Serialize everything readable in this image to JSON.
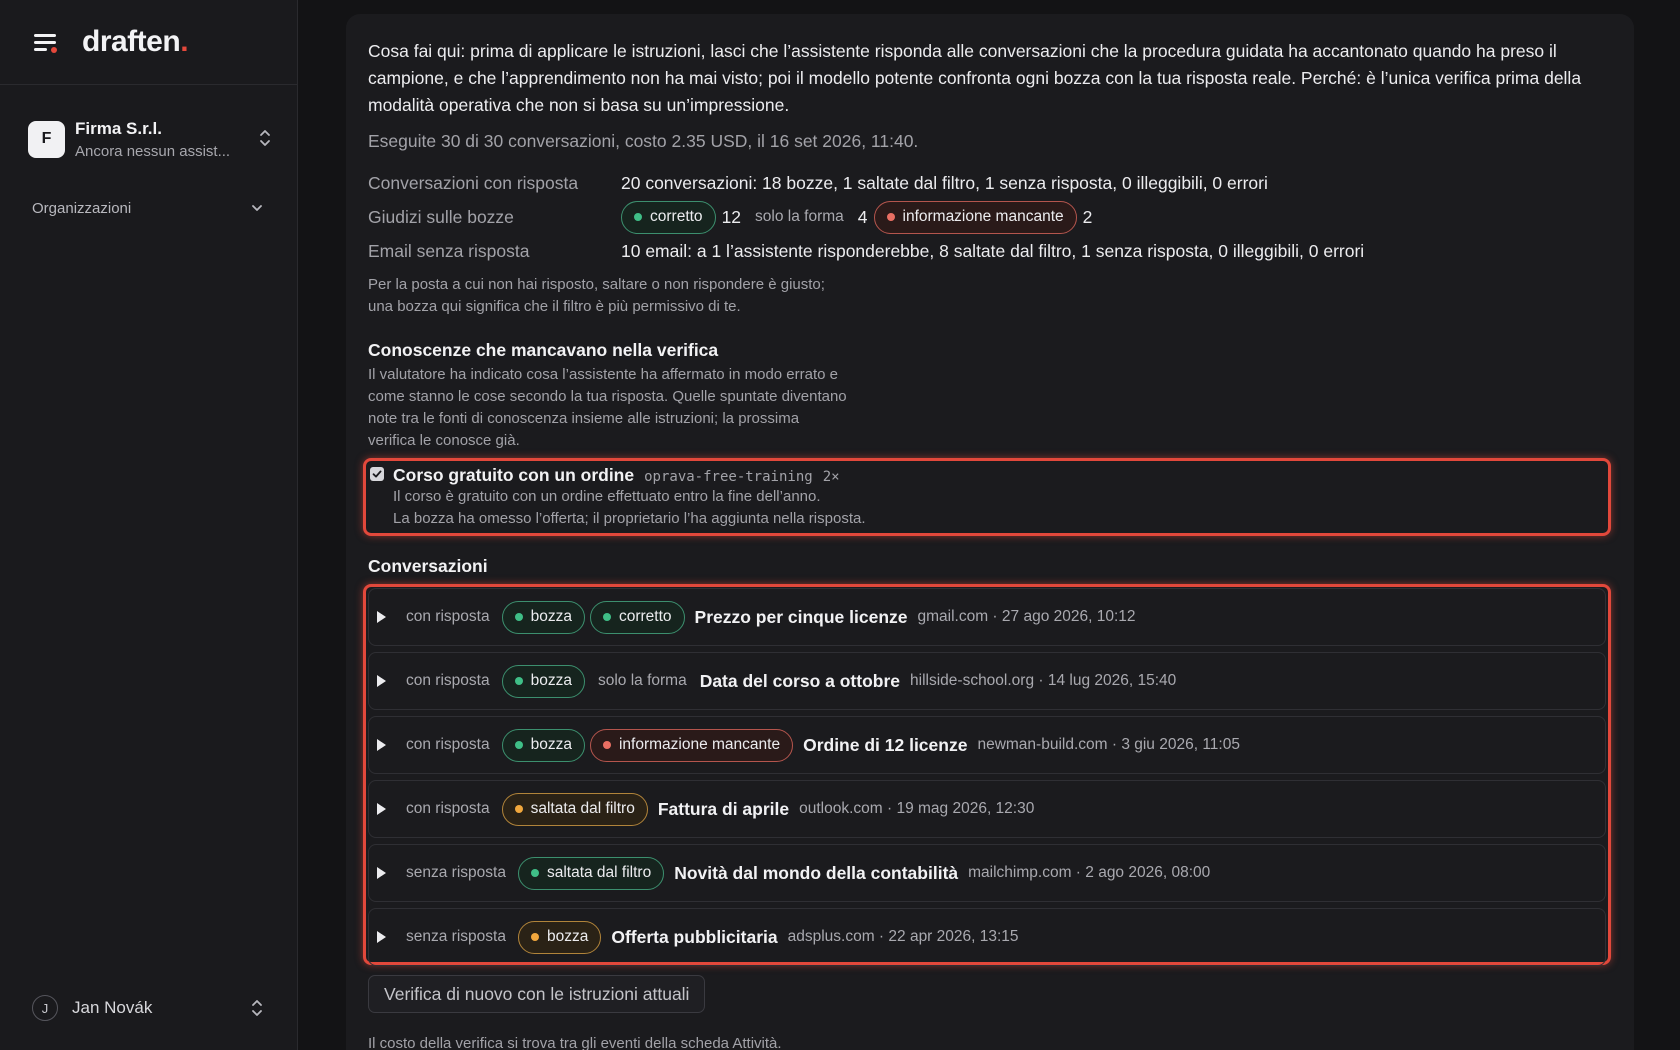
{
  "brand": {
    "name": "draften",
    "dot": "."
  },
  "org": {
    "initial": "F",
    "name": "Firma S.r.l.",
    "subtitle": "Ancora nessun assist..."
  },
  "sidebar": {
    "section_label": "Organizzazioni"
  },
  "user": {
    "initial": "J",
    "name": "Jan Novák"
  },
  "intro": "Cosa fai qui: prima di applicare le istruzioni, lasci che l’assistente risponda alle conversazioni che la procedura guidata ha accantonato quando ha preso il campione, e che l’apprendimento non ha mai visto; poi il modello potente confronta ogni bozza con la tua risposta reale. Perché: è l’unica verifica prima della modalità operativa che non si basa su un’impressione.",
  "run_meta": "Eseguite 30 di 30 conversazioni, costo 2.35 USD, il 16 set 2026, 11:40.",
  "stats": {
    "replied_label": "Conversazioni con risposta",
    "replied_value": "20 conversazioni: 18 bozze, 1 saltate dal filtro, 1 senza risposta, 0 illeggibili, 0 errori",
    "judgements_label": "Giudizi sulle bozze",
    "judgements": {
      "correct_label": "corretto",
      "correct_count": "12",
      "form_label": "solo la forma",
      "form_count": "4",
      "missing_label": "informazione mancante",
      "missing_count": "2"
    },
    "unreplied_label": "Email senza risposta",
    "unreplied_value": "10 email: a 1 l’assistente risponderebbe, 8 saltate dal filtro, 1 senza risposta, 0 illeggibili, 0 errori",
    "note_line1": "Per la posta a cui non hai risposto, saltare o non rispondere è giusto;",
    "note_line2": "una bozza qui significa che il filtro è più permissivo di te."
  },
  "knowledge": {
    "title": "Conoscenze che mancavano nella verifica",
    "desc_line1": "Il valutatore ha indicato cosa l’assistente ha affermato in modo errato e",
    "desc_line2": "come stanno le cose secondo la tua risposta. Quelle spuntate diventano",
    "desc_line3": "note tra le fonti di conoscenza insieme alle istruzioni; la prossima",
    "desc_line4": "verifica le conosce già.",
    "item": {
      "checked": true,
      "title": "Corso gratuito con un ordine",
      "code": "oprava-free-training",
      "multiplier": "2×",
      "line1": "Il corso è gratuito con un ordine effettuato entro la fine dell’anno.",
      "line2": "La bozza ha omesso l’offerta; il proprietario l’ha aggiunta nella risposta."
    }
  },
  "conversations": {
    "title": "Conversazioni",
    "rows": [
      {
        "status": "con risposta",
        "tag1": "bozza",
        "tag2": "corretto",
        "subject": "Prezzo per cinque licenze",
        "meta": "gmail.com · 27 ago 2026, 10:12"
      },
      {
        "status": "con risposta",
        "tag1": "bozza",
        "tag2": "solo la forma",
        "subject": "Data del corso a ottobre",
        "meta": "hillside-school.org · 14 lug 2026, 15:40"
      },
      {
        "status": "con risposta",
        "tag1": "bozza",
        "tag2": "informazione mancante",
        "subject": "Ordine di 12 licenze",
        "meta": "newman-build.com · 3 giu 2026, 11:05"
      },
      {
        "status": "con risposta",
        "tag1": "saltata dal filtro",
        "subject": "Fattura di aprile",
        "meta": "outlook.com · 19 mag 2026, 12:30"
      },
      {
        "status": "senza risposta",
        "tag1": "saltata dal filtro",
        "subject": "Novità dal mondo della contabilità",
        "meta": "mailchimp.com · 2 ago 2026, 08:00"
      },
      {
        "status": "senza risposta",
        "tag1": "bozza",
        "subject": "Offerta pubblicitaria",
        "meta": "adsplus.com · 22 apr 2026, 13:15"
      }
    ]
  },
  "actions": {
    "rerun_label": "Verifica di nuovo con le istruzioni attuali"
  },
  "footer_note": "Il costo della verifica si trova tra gli eventi della scheda Attività.",
  "colors": {
    "accent": "#e2483b",
    "green": "#3fbf87",
    "red": "#e96f63",
    "amber": "#f1a73d"
  }
}
